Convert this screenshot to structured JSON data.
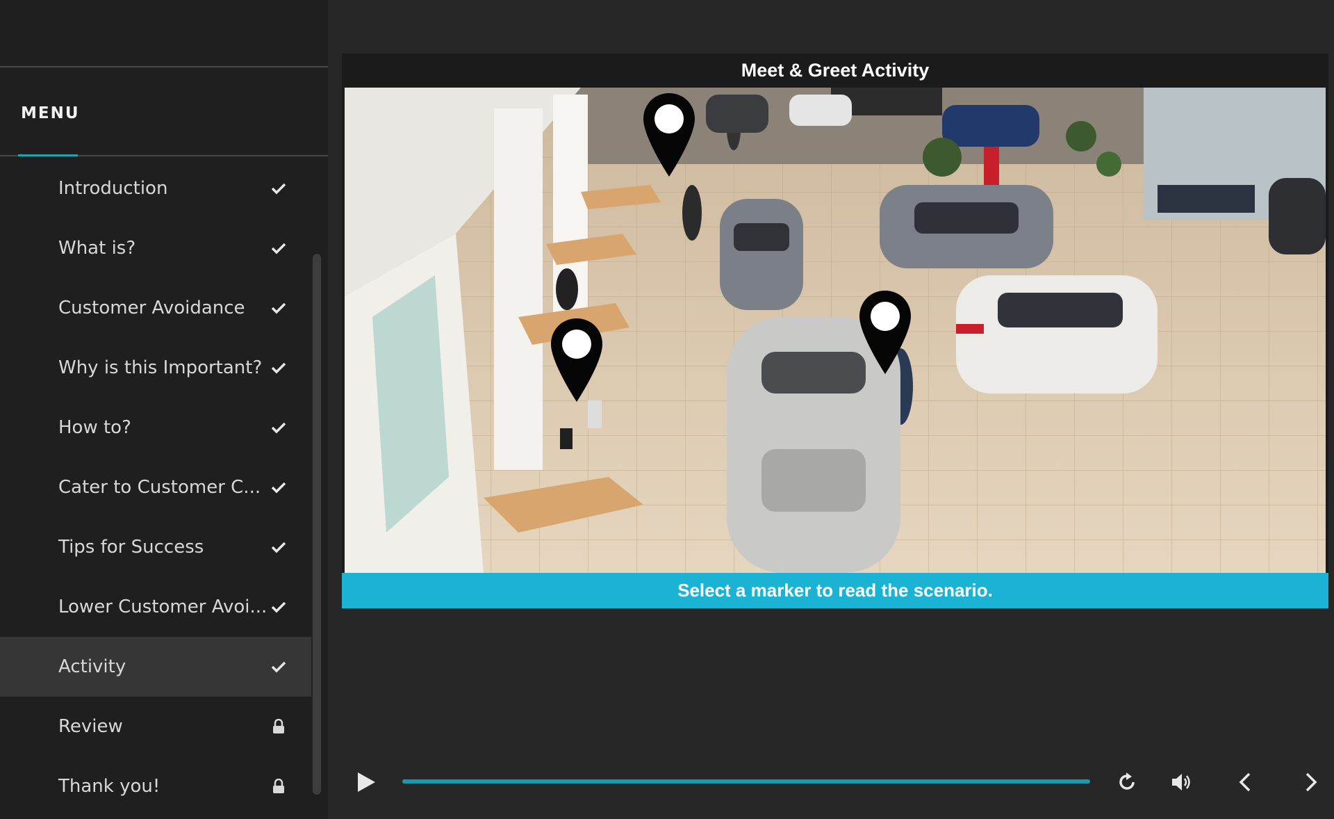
{
  "sidebar": {
    "menu_label": "MENU",
    "items": [
      {
        "label": "Introduction",
        "status": "completed",
        "icon": "check-icon"
      },
      {
        "label": "What is?",
        "status": "completed",
        "icon": "check-icon"
      },
      {
        "label": "Customer Avoidance",
        "status": "completed",
        "icon": "check-icon"
      },
      {
        "label": "Why is this Important?",
        "status": "completed",
        "icon": "check-icon"
      },
      {
        "label": "How to?",
        "status": "completed",
        "icon": "check-icon"
      },
      {
        "label": "Cater to Customer C...",
        "status": "completed",
        "icon": "check-icon"
      },
      {
        "label": "Tips for Success",
        "status": "completed",
        "icon": "check-icon"
      },
      {
        "label": "Lower Customer Avoi...",
        "status": "completed",
        "icon": "check-icon"
      },
      {
        "label": "Activity",
        "status": "completed",
        "icon": "check-icon",
        "active": true
      },
      {
        "label": "Review",
        "status": "locked",
        "icon": "lock-icon"
      },
      {
        "label": "Thank you!",
        "status": "locked",
        "icon": "lock-icon"
      }
    ]
  },
  "slide": {
    "title": "Meet & Greet Activity",
    "instruction": "Select a marker to read the scenario.",
    "scene_icon": "car-showroom-photo",
    "markers": [
      {
        "icon": "map-marker-icon"
      },
      {
        "icon": "map-marker-icon"
      },
      {
        "icon": "map-marker-icon"
      }
    ]
  },
  "player": {
    "progress": 1.0,
    "buttons": [
      "play-icon",
      "replay-icon",
      "volume-icon",
      "previous-icon",
      "next-icon"
    ]
  },
  "colors": {
    "accent": "#1bb3d3",
    "sidebar_bg": "#1f1f1f",
    "main_bg": "#272727",
    "active_item_bg": "#363636"
  }
}
